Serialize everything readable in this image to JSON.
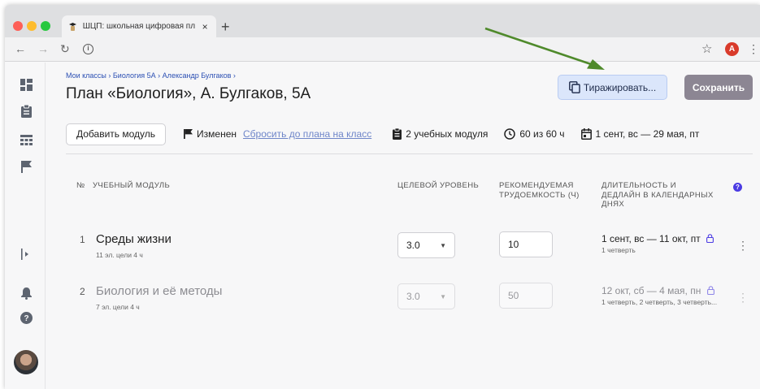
{
  "browser": {
    "tab_title": "ШЦП: школьная цифровая пла",
    "tab_close": "×",
    "new_tab": "+",
    "profile_initial": "A"
  },
  "breadcrumb": "Мои классы › Биология 5А › Александр Булгаков ›",
  "page_title": "План «Биология», А. Булгаков, 5А",
  "buttons": {
    "replicate": "Тиражировать...",
    "save": "Сохранить",
    "add_module": "Добавить модуль"
  },
  "info_bar": {
    "status": "Изменен",
    "reset_link": "Сбросить до плана на класс",
    "modules_count": "2 учебных модуля",
    "hours": "60 из 60 ч",
    "dates": "1 сент, вс — 29 мая, пт"
  },
  "table": {
    "headers": {
      "num": "№",
      "module": "УЧЕБНЫЙ МОДУЛЬ",
      "level": "ЦЕЛЕВОЙ УРОВЕНЬ",
      "effort_line1": "РЕКОМЕНДУЕМАЯ",
      "effort_line2": "ТРУДОЕМКОСТЬ (Ч)",
      "deadline_line1": "ДЛИТЕЛЬНОСТЬ И",
      "deadline_line2": "ДЕДЛАЙН В КАЛЕНДАРНЫХ",
      "deadline_line3": "ДНЯХ"
    },
    "rows": [
      {
        "num": "1",
        "title": "Среды жизни",
        "meta": "11 эл. цели    4 ч",
        "level": "3.0",
        "effort": "10",
        "deadline": "1 сент, вс — 11 окт, пт",
        "deadline_sub": "1 четверть"
      },
      {
        "num": "2",
        "title": "Биология и её методы",
        "meta": "7 эл. цели    4 ч",
        "level": "3.0",
        "effort": "50",
        "deadline": "12 окт, сб — 4 мая, пн",
        "deadline_sub": "1 четверть, 2 четверть, 3 четверть..."
      }
    ]
  },
  "colors": {
    "accent": "#2b4fb3",
    "save_button": "#8c8693",
    "replicate_button": "#dbe6fb",
    "annotation_arrow": "#4f8a2b"
  }
}
